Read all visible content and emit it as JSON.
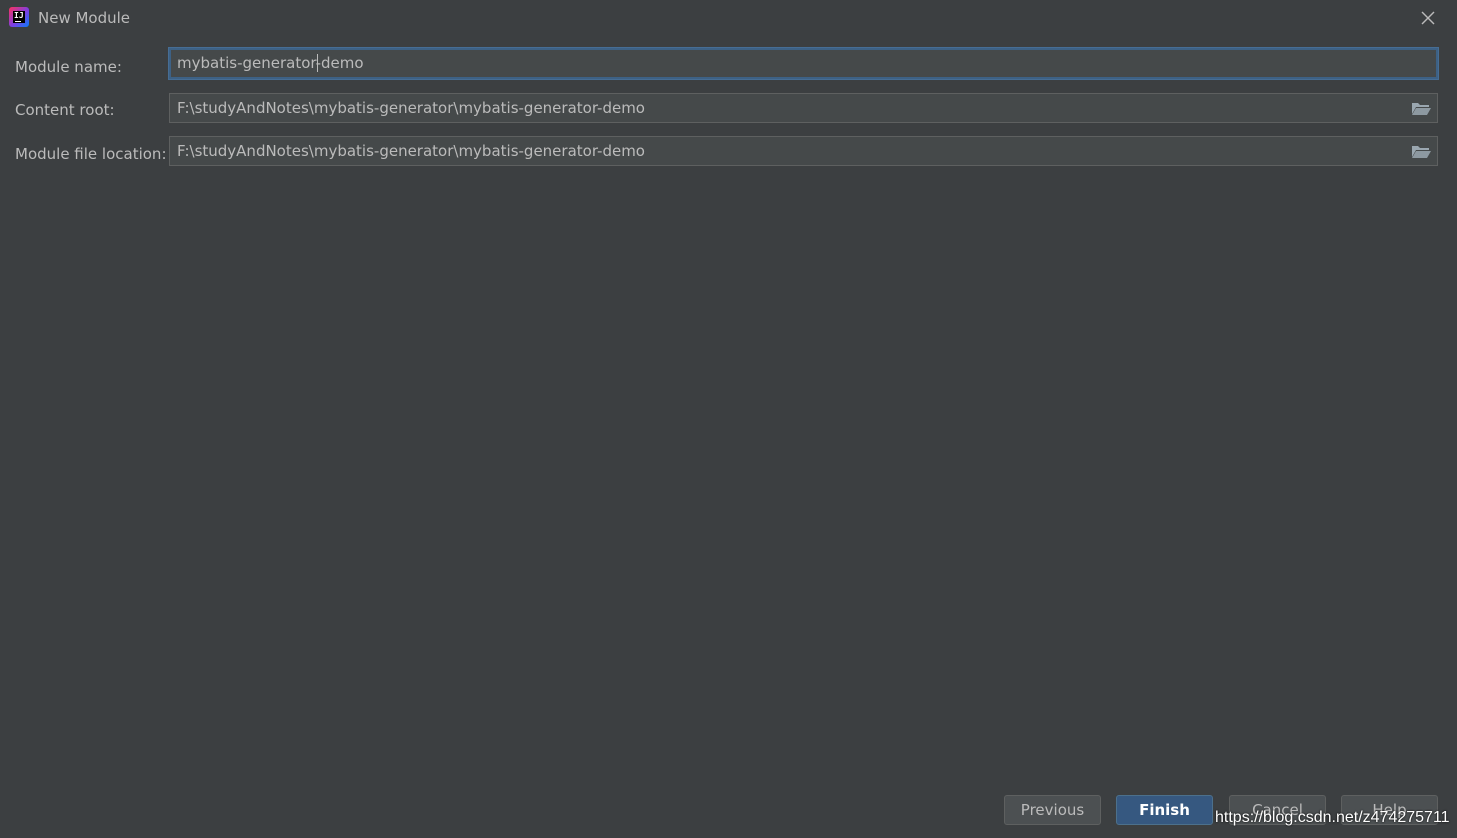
{
  "window": {
    "title": "New Module",
    "app_icon": "intellij-idea-icon",
    "close_icon": "close-icon"
  },
  "form": {
    "module_name": {
      "label": "Module name:",
      "value": "mybatis-generator-demo"
    },
    "content_root": {
      "label": "Content root:",
      "value": "F:\\studyAndNotes\\mybatis-generator\\mybatis-generator-demo",
      "icon": "folder-icon"
    },
    "module_file_location": {
      "label": "Module file location:",
      "value": "F:\\studyAndNotes\\mybatis-generator\\mybatis-generator-demo",
      "icon": "folder-icon"
    }
  },
  "buttons": {
    "previous": "Previous",
    "finish": "Finish",
    "cancel": "Cancel",
    "help": "Help"
  },
  "watermark": "https://blog.csdn.net/z474275711",
  "colors": {
    "background": "#3c3f41",
    "field_bg": "#45494a",
    "focus_border": "#3d6185",
    "default_button": "#365880",
    "text": "#bbbbbb"
  }
}
